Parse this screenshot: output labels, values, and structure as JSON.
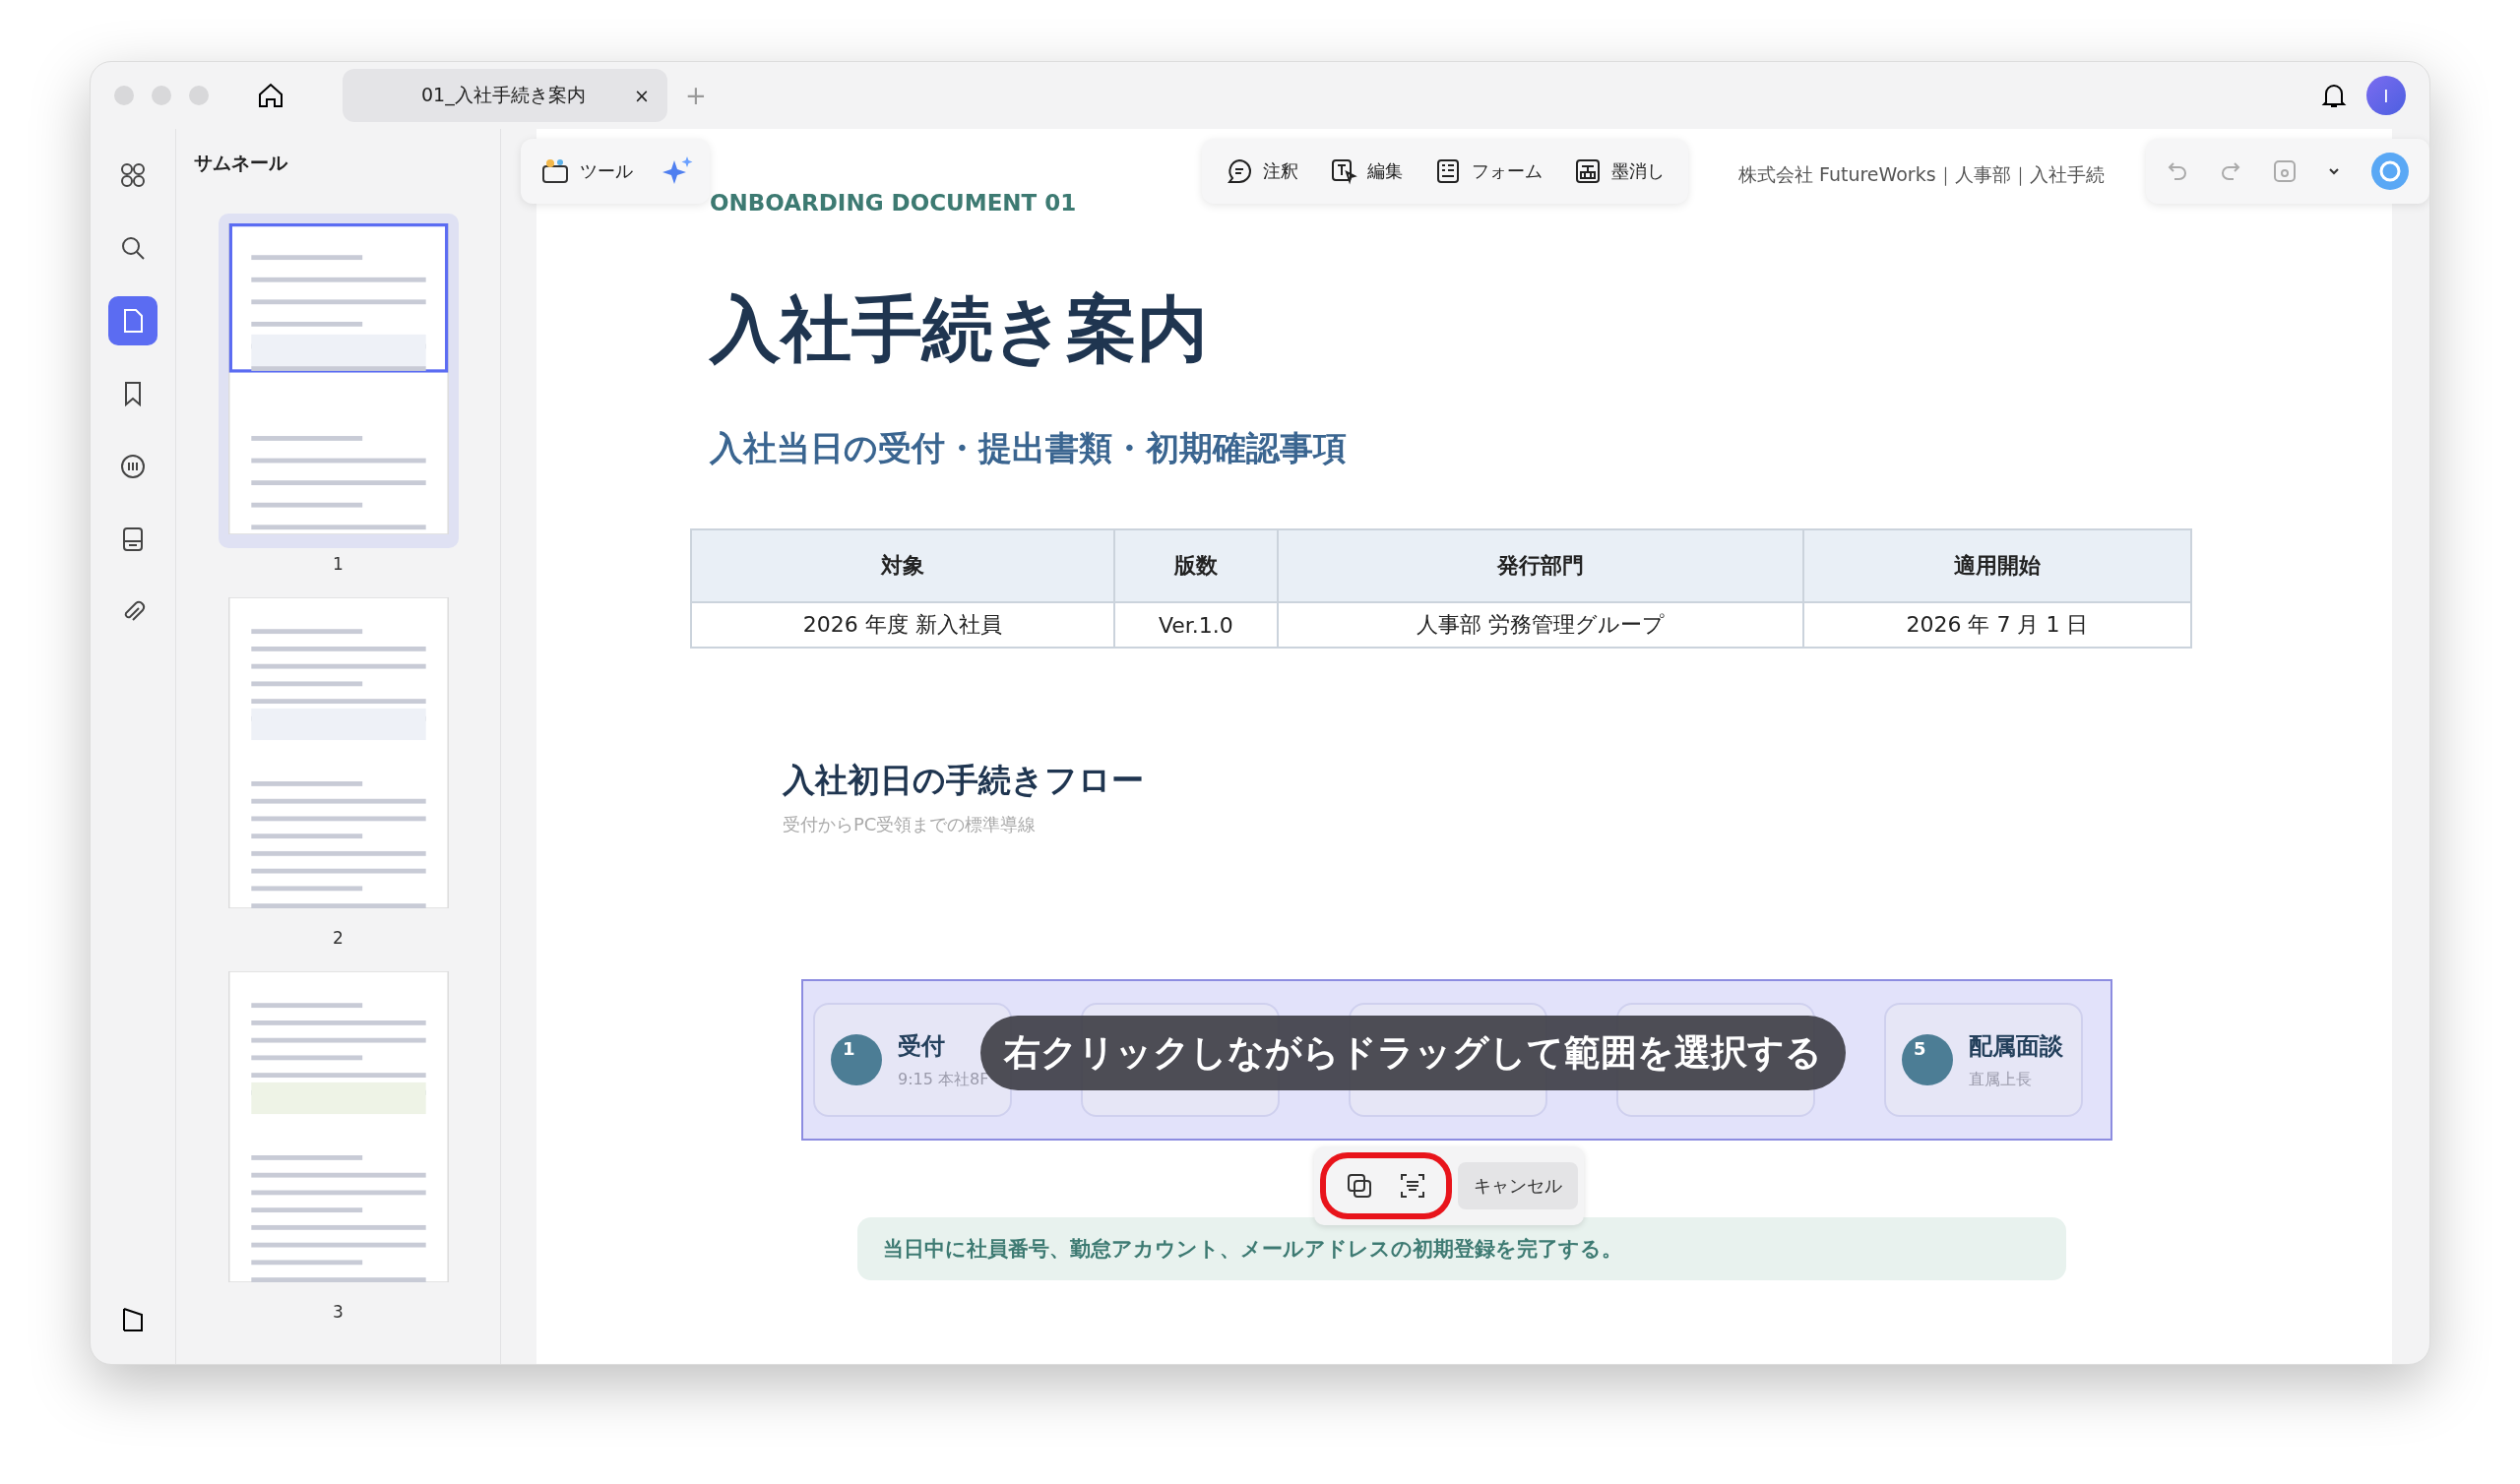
{
  "window": {
    "tabs": [
      {
        "title": "01_入社手続き案内",
        "close": "×",
        "selected": true
      }
    ],
    "new_tab": "+",
    "avatar": "I"
  },
  "rail": {
    "items": [
      {
        "kind": "grid",
        "selected": false
      },
      {
        "kind": "search",
        "selected": false
      },
      {
        "kind": "page",
        "selected": true
      },
      {
        "kind": "bookmark",
        "selected": false
      },
      {
        "kind": "comment",
        "selected": false
      },
      {
        "kind": "stamp",
        "selected": false
      },
      {
        "kind": "clip",
        "selected": false
      }
    ]
  },
  "sidebar": {
    "title": "サムネール",
    "thumbnails": [
      {
        "label": "1",
        "selected": true
      },
      {
        "label": "2",
        "selected": false
      },
      {
        "label": "3",
        "selected": false
      }
    ]
  },
  "toolbar": {
    "tools": "ツール",
    "items": [
      {
        "kind": "comment",
        "label": "注釈"
      },
      {
        "kind": "edit",
        "label": "編集"
      },
      {
        "kind": "form",
        "label": "フォーム"
      },
      {
        "kind": "redact",
        "label": "墨消し"
      }
    ],
    "breadcrumb": "株式会社 FutureWorks｜人事部｜入社手続"
  },
  "document": {
    "eyebrow": "ONBOARDING DOCUMENT 01",
    "title": "入社手続き案内",
    "subtitle": "入社当日の受付・提出書類・初期確認事項",
    "table": {
      "columns": [
        "対象",
        "版数",
        "発行部門",
        "適用開始"
      ],
      "rows": [
        [
          "2026 年度 新入社員",
          "Ver.1.0",
          "人事部 労務管理グループ",
          "2026 年 7 月 1 日"
        ]
      ]
    },
    "flow_title": "入社初日の手続きフロー",
    "flow_subtitle": "受付からPC受領までの標準導線",
    "steps": [
      {
        "kind": "shown",
        "number": "1",
        "title": "受付",
        "sub": "9:15 本社8F"
      },
      {
        "kind": "covered"
      },
      {
        "kind": "covered"
      },
      {
        "kind": "covered"
      },
      {
        "kind": "shown",
        "number": "5",
        "title": "配属面談",
        "sub": "直属上長"
      }
    ],
    "note": "当日中に社員番号、勤怠アカウント、メールアドレスの初期登録を完了する。"
  },
  "selection": {
    "hint": "右クリックしながらドラッグして範囲を選択する",
    "cancel": "キャンセル"
  }
}
